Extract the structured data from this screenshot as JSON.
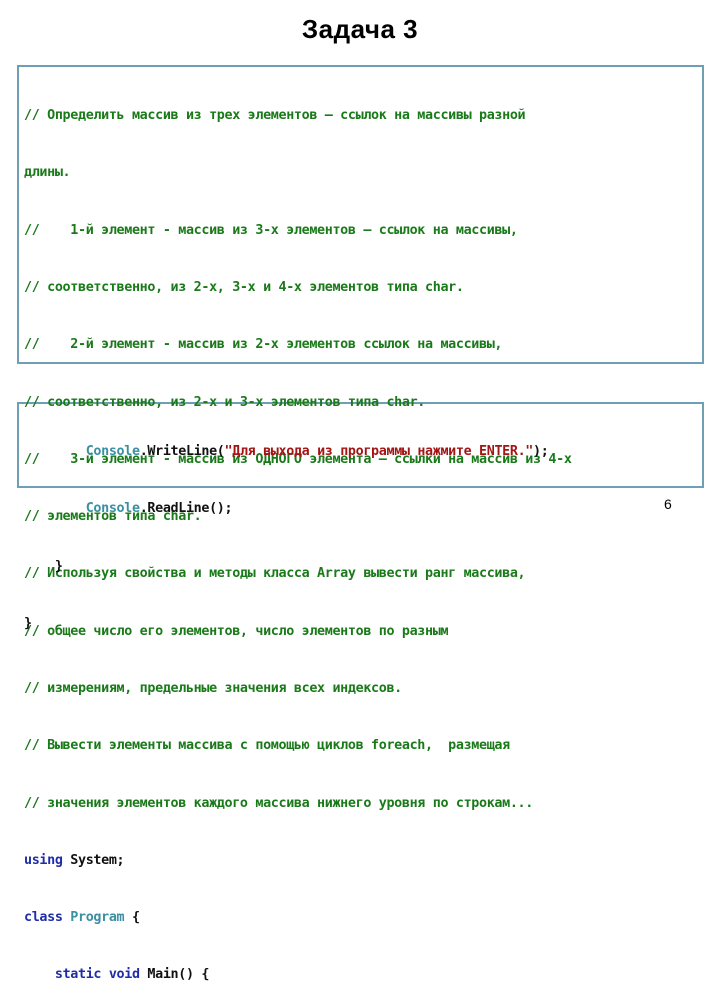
{
  "title": "Задача 3",
  "page_number": "6",
  "colors": {
    "comment": "#1a7a1a",
    "keyword": "#1f2ea8",
    "type": "#3a8fa3",
    "string": "#a31515",
    "border": "#6f9fb4"
  },
  "code_block_1": {
    "comments": [
      "// Определить массив из трех элементов – ссылок на массивы разной",
      "длины.",
      "//    1-й элемент - массив из 3-х элементов – ссылок на массивы,",
      "// соответственно, из 2-х, 3-х и 4-х элементов типа char.",
      "//    2-й элемент - массив из 2-х элементов ссылок на массивы,",
      "// соответственно, из 2-х и 3-х элементов типа char.",
      "//    3-й элемент - массив из ОДНОГО элемента – ссылки на массив из 4-х",
      "// элементов типа char.",
      "// Используя свойства и методы класса Array вывести ранг массива,",
      "// общее число его элементов, число элементов по разным",
      "// измерениям, предельные значения всех индексов.",
      "// Вывести элементы массива с помощью циклов foreach,  размещая",
      "// значения элементов каждого массива нижнего уровня по строкам..."
    ],
    "using_keyword": "using",
    "using_rest": " System;",
    "class_keyword": "class",
    "class_name": "Program",
    "class_brace": " {",
    "main_indent": "    ",
    "static_void": "static void",
    "main_rest": " Main() {"
  },
  "code_block_2": {
    "line1_indent": "        ",
    "console1": "Console",
    "writeline": ".WriteLine(",
    "string": "\"Для выхода из программы нажмите ENTER.\"",
    "writeline_end": ");",
    "line2_indent": "        ",
    "console2": "Console",
    "readline": ".ReadLine();",
    "line3": "    }",
    "line4": "}"
  }
}
